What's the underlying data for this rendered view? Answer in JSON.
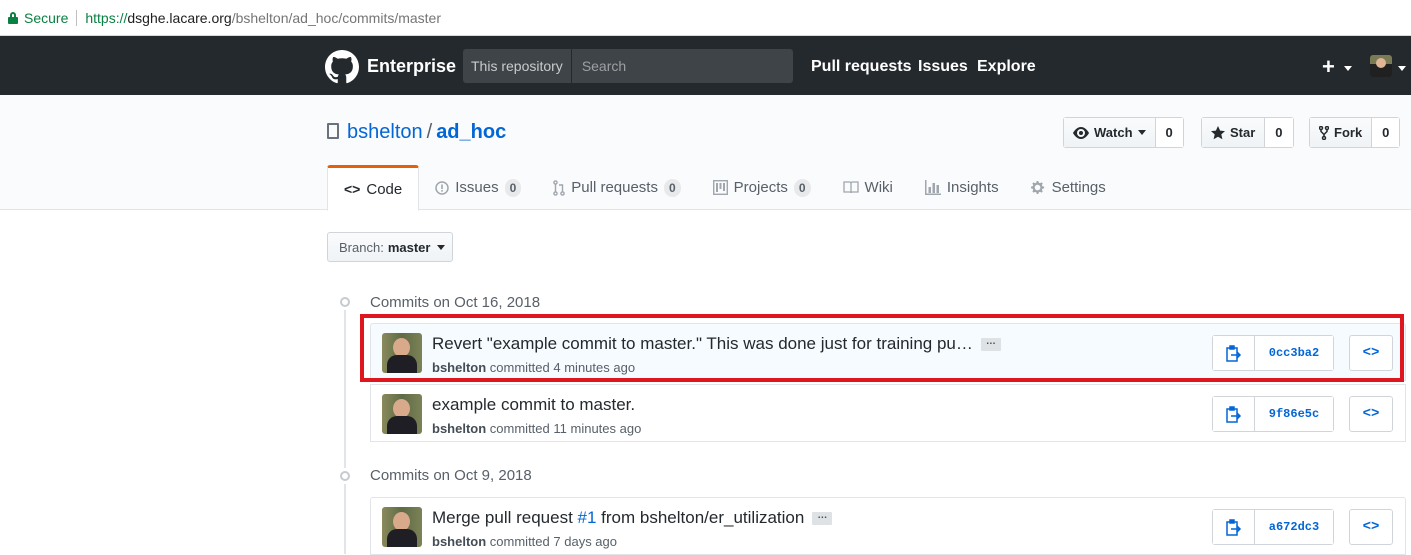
{
  "browser": {
    "secure_label": "Secure",
    "url_scheme": "https://",
    "url_host": "dsghe.lacare.org",
    "url_path": "/bshelton/ad_hoc/commits/master"
  },
  "header": {
    "brand": "Enterprise",
    "search_scope": "This repository",
    "search_placeholder": "Search",
    "nav": [
      "Pull requests",
      "Issues",
      "Explore"
    ],
    "plus": "+"
  },
  "repo": {
    "owner": "bshelton",
    "separator": "/",
    "name": "ad_hoc",
    "watch_label": "Watch",
    "watch_count": "0",
    "star_label": "Star",
    "star_count": "0",
    "fork_label": "Fork",
    "fork_count": "0"
  },
  "tabs": [
    {
      "label": "Code",
      "icon": "code-icon"
    },
    {
      "label": "Issues",
      "icon": "issue-icon",
      "count": "0"
    },
    {
      "label": "Pull requests",
      "icon": "pull-request-icon",
      "count": "0"
    },
    {
      "label": "Projects",
      "icon": "project-icon",
      "count": "0"
    },
    {
      "label": "Wiki",
      "icon": "book-icon"
    },
    {
      "label": "Insights",
      "icon": "graph-icon"
    },
    {
      "label": "Settings",
      "icon": "gear-icon"
    }
  ],
  "branch": {
    "label": "Branch:",
    "value": "master"
  },
  "groups": [
    {
      "title": "Commits on Oct 16, 2018",
      "commits": [
        {
          "message": "Revert \"example commit to master.\" This was done just for training pu…",
          "author": "bshelton",
          "verb": "committed",
          "time": "4 minutes ago",
          "sha": "0cc3ba2",
          "has_ellipsis": true
        },
        {
          "message": "example commit to master.",
          "author": "bshelton",
          "verb": "committed",
          "time": "11 minutes ago",
          "sha": "9f86e5c",
          "has_ellipsis": false
        }
      ]
    },
    {
      "title": "Commits on Oct 9, 2018",
      "commits": [
        {
          "message_pre": "Merge pull request ",
          "issue_ref": "#1",
          "message_post": " from bshelton/er_utilization",
          "author": "bshelton",
          "verb": "committed",
          "time": "7 days ago",
          "sha": "a672dc3",
          "has_ellipsis": true
        }
      ]
    }
  ],
  "browse_label": "<>",
  "colors": {
    "header_bg": "#24292e",
    "link": "#0366d6",
    "tab_accent": "#e36209",
    "highlight_box": "#e0161e"
  }
}
